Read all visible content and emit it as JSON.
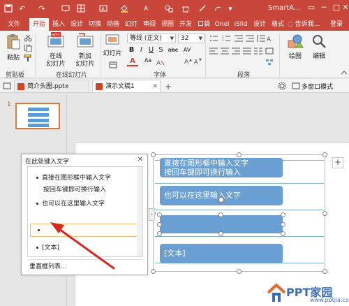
{
  "titlebar": {
    "app_title": "SmartA...",
    "colors": {
      "bar": "#c8463a"
    }
  },
  "tabs": [
    {
      "label": "文件"
    },
    {
      "label": "开始"
    },
    {
      "label": "插入"
    },
    {
      "label": "设计"
    },
    {
      "label": "切换"
    },
    {
      "label": "动画"
    },
    {
      "label": "幻灯"
    },
    {
      "label": "审阅"
    },
    {
      "label": "视图"
    },
    {
      "label": "开发"
    },
    {
      "label": "口袋"
    },
    {
      "label": "Onel"
    },
    {
      "label": "iSlid"
    },
    {
      "label": "设计"
    },
    {
      "label": "格式"
    },
    {
      "label": "告诉我..."
    },
    {
      "label": "登录"
    }
  ],
  "ribbon": {
    "paste": "粘贴",
    "online_slides_1": "在线",
    "online_slides_2": "幻灯片",
    "new_slide_1": "新加",
    "new_slide_2": "幻灯片",
    "slide_small": "幻灯片",
    "font_name": "等线 (正文)",
    "font_size": "32",
    "drawing": "绘图",
    "editing": "编辑",
    "groups": {
      "clipboard": "剪贴板",
      "online_slides": "在线幻灯片",
      "font": "字体",
      "paragraph": "段落"
    },
    "format_buttons": [
      "B",
      "I",
      "U",
      "S",
      "abc",
      "AV",
      "Aa",
      "A"
    ]
  },
  "doc_tabs": [
    {
      "label": "简介头图.pptx"
    },
    {
      "label": "演示文稿1"
    }
  ],
  "multi_window": "多窗口模式",
  "thumbnail": {
    "number": "1"
  },
  "text_pane": {
    "title": "在此处键入文字",
    "items": [
      {
        "text": "直接在图形框中输入文字"
      },
      {
        "text": "按回车键即可换行输入"
      },
      {
        "text": "也可以在这里输入文字"
      },
      {
        "text": ""
      },
      {
        "text": "[文本]"
      }
    ],
    "footer_link": "垂直框列表..."
  },
  "smartart": {
    "boxes": [
      {
        "line1": "直接在图形框中输入文字",
        "line2": "按回车键即可换行输入"
      },
      {
        "line1": "也可以在这里输入文字"
      },
      {
        "line1": ""
      },
      {
        "line1": "[文本]"
      }
    ],
    "colors": {
      "box": "#6a9fd4",
      "line": "#7fb0d8"
    }
  },
  "logo": {
    "name": "PPT家园",
    "url": "www.pptjia.com"
  }
}
